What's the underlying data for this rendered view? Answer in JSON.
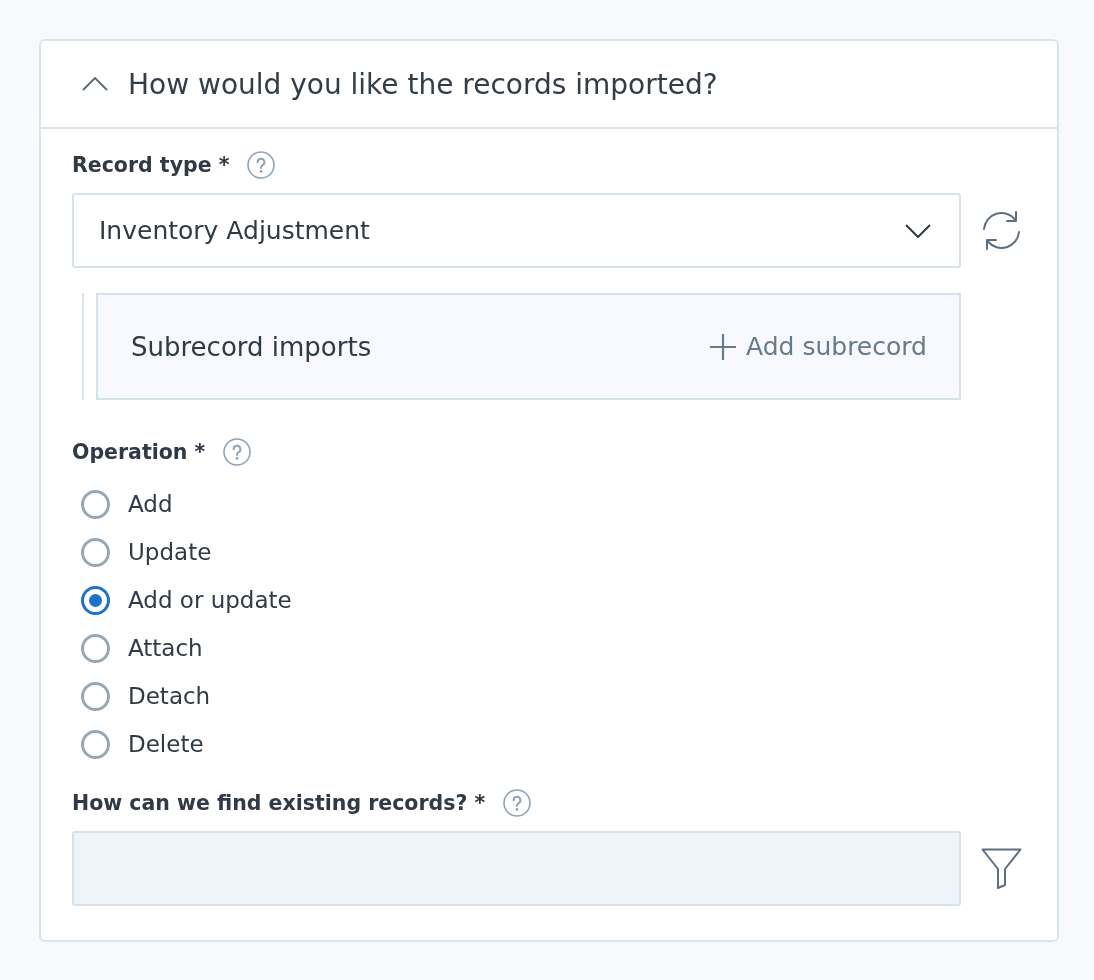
{
  "section": {
    "title": "How would you like the records imported?",
    "expanded": true
  },
  "record_type": {
    "label": "Record type *",
    "value": "Inventory Adjustment"
  },
  "subrecords": {
    "title": "Subrecord imports",
    "add_button": "Add subrecord"
  },
  "operation": {
    "label": "Operation *",
    "options": [
      {
        "label": "Add",
        "selected": false
      },
      {
        "label": "Update",
        "selected": false
      },
      {
        "label": "Add or update",
        "selected": true
      },
      {
        "label": "Attach",
        "selected": false
      },
      {
        "label": "Detach",
        "selected": false
      },
      {
        "label": "Delete",
        "selected": false
      }
    ]
  },
  "find_records": {
    "label": "How can we find existing records? *",
    "disabled": true
  }
}
